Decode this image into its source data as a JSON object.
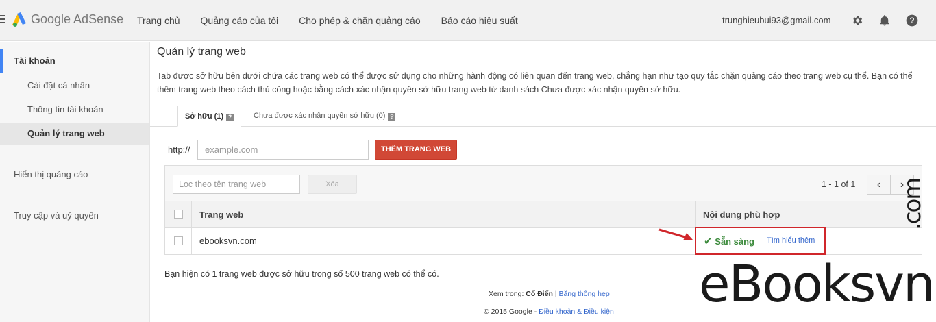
{
  "header": {
    "brand": "Google AdSense",
    "nav": [
      "Trang chủ",
      "Quảng cáo của tôi",
      "Cho phép & chặn quảng cáo",
      "Báo cáo hiệu suất"
    ],
    "email": "trunghieubui93@gmail.com",
    "icons": [
      "gear-icon",
      "bell-icon",
      "help-icon"
    ]
  },
  "sidebar": {
    "section_account": "Tài khoản",
    "items": [
      "Cài đặt cá nhân",
      "Thông tin tài khoản",
      "Quản lý trang web"
    ],
    "section_ads": "Hiển thị quảng cáo",
    "section_access": "Truy cập và uỷ quyền"
  },
  "main": {
    "title": "Quản lý trang web",
    "description": "Tab được sở hữu bên dưới chứa các trang web có thể được sử dụng cho những hành động có liên quan đến trang web, chẳng hạn như tạo quy tắc chặn quảng cáo theo trang web cụ thể. Bạn có thể thêm trang web theo cách thủ công hoặc bằng cách xác nhận quyền sở hữu trang web từ danh sách Chưa được xác nhận quyền sở hữu.",
    "tabs": [
      {
        "label": "Sở hữu (1)",
        "icon": "?"
      },
      {
        "label": "Chưa được xác nhận quyền sở hữu (0)",
        "icon": "?"
      }
    ],
    "http_label": "http://",
    "url_placeholder": "example.com",
    "add_button": "THÊM TRANG WEB",
    "filter_placeholder": "Lọc theo tên trang web",
    "clear_button": "Xóa",
    "pager_text": "1 - 1 of 1",
    "columns": [
      "Trang web",
      "Nội dung phù hợp"
    ],
    "rows": [
      {
        "site": "ebooksvn.com",
        "status": "Sẵn sàng",
        "learn_more": "Tìm hiểu thêm"
      }
    ],
    "owned_note": "Bạn hiện có 1 trang web được sở hữu trong số 500 trang web có thể có.",
    "footer": {
      "view_in": "Xem trong:",
      "classic": "Cổ Điển",
      "sep": "|",
      "narrow": "Băng thông hẹp",
      "copyright": "© 2015 Google -",
      "terms": "Điều khoản & Điều kiện"
    }
  },
  "watermark": {
    "main": "eBooksvn",
    "tld": ".com"
  },
  "colors": {
    "accent_blue": "#4285f4",
    "add_button_red": "#d14836",
    "ready_green": "#3d8b3d",
    "highlight_red": "#d0262b"
  }
}
